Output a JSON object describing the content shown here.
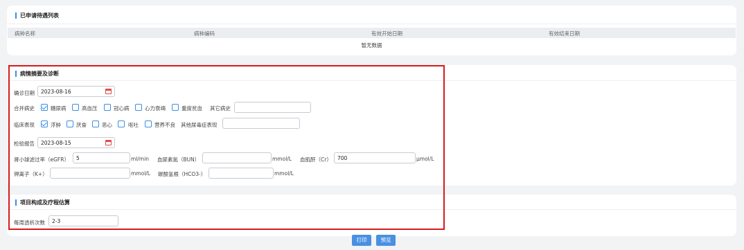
{
  "registered_list": {
    "title": "已申请待遇列表",
    "columns": [
      "病种名称",
      "病种编码",
      "有效开始日期",
      "有效结束日期"
    ],
    "empty_text": "暂无数据"
  },
  "diagnosis": {
    "title": "病情摘要及诊断",
    "diagnosis_date_label": "确诊日期",
    "diagnosis_date_value": "2023-08-16",
    "comorbidity_label": "合并病史",
    "comorbidities": [
      {
        "label": "糖尿病",
        "checked": true
      },
      {
        "label": "高血压",
        "checked": false
      },
      {
        "label": "冠心病",
        "checked": false
      },
      {
        "label": "心力衰竭",
        "checked": false
      },
      {
        "label": "重度贫血",
        "checked": false
      }
    ],
    "other_history_label": "其它病史",
    "other_history_value": "",
    "clinical_label": "临床表现",
    "clinical": [
      {
        "label": "浮肿",
        "checked": true
      },
      {
        "label": "厌食",
        "checked": false
      },
      {
        "label": "恶心",
        "checked": false
      },
      {
        "label": "呕吐",
        "checked": false
      },
      {
        "label": "营养不良",
        "checked": false
      }
    ],
    "other_uremia_label": "其他尿毒症表现",
    "other_uremia_value": "",
    "lab_report_label": "检验报告",
    "lab_report_value": "2023-08-15",
    "egfr_label": "肾小球滤过率（eGFR）",
    "egfr_value": "5",
    "egfr_unit": "ml/min",
    "bun_label": "血尿素氮（BUN）",
    "bun_value": "",
    "bun_unit": "mmol/L",
    "cr_label": "血肌酐（Cr）",
    "cr_value": "700",
    "cr_unit": "μmol/L",
    "k_label": "钾离子（K+）",
    "k_value": "",
    "k_unit": "mmol/L",
    "hco3_label": "碳酸氢根（HCO3-）",
    "hco3_value": "",
    "hco3_unit": "mmol/L"
  },
  "project": {
    "title": "项目构成及疗程估算",
    "weekly_label": "每周透析次数",
    "weekly_value": "2-3"
  },
  "buttons": {
    "print": "打印",
    "preview": "预览"
  },
  "colors": {
    "accent": "#3a8ee6",
    "highlight_border": "#d7191c"
  }
}
